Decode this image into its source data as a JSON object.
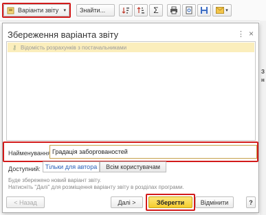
{
  "toolbar": {
    "variants_label": "Варіанти звіту",
    "find_label": "Знайти..."
  },
  "dialog": {
    "title": "Збереження варіанта звіту",
    "menu_icon": "more-icon",
    "close_icon": "close-icon",
    "list_items": [
      {
        "label": "Відомість розрахунків з постачальниками",
        "icon": "key-icon"
      }
    ],
    "name_label": "Найменування:",
    "name_value": "Градація заборгованостей",
    "available_label": "Доступний:",
    "access_options": [
      "Тільки для автора",
      "Всім користувачам"
    ],
    "access_selected": "Тільки для автора",
    "note_lines": [
      "Буде збережено новий варіант звіту.",
      "Натисніть \"Далі\" для розміщення варіанту звіту в розділах програми."
    ],
    "buttons": {
      "back": "< Назад",
      "next": "Далі >",
      "save": "Зберегти",
      "cancel": "Відмінити",
      "help": "?"
    }
  },
  "background": {
    "right_column": [
      "З",
      "н"
    ]
  },
  "colors": {
    "highlight_red": "#d21a1a",
    "accent_yellow": "#f5cc2c",
    "selected_row": "#fbeebc",
    "link_blue": "#2a62b8"
  }
}
